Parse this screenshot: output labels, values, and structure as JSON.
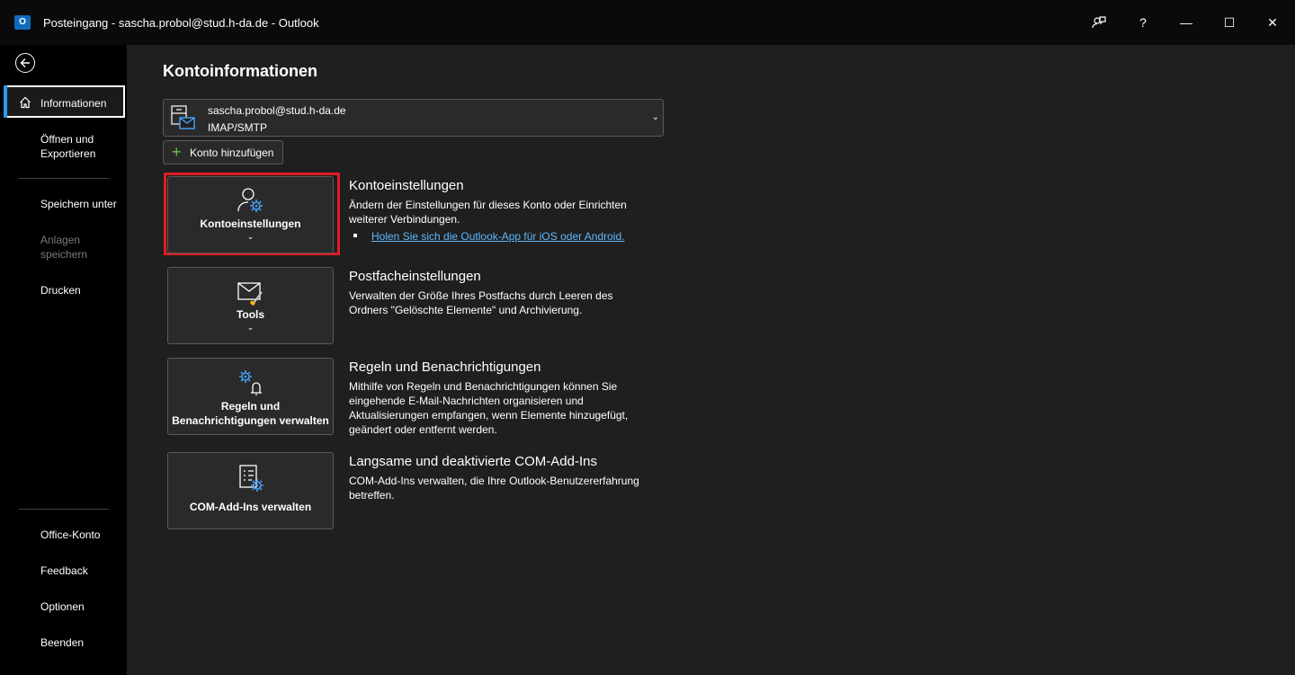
{
  "window": {
    "title": "Posteingang - sascha.probol@stud.h-da.de  -  Outlook",
    "app_icon": "outlook-logo",
    "app_icon_letter": "O",
    "controls": [
      "feedback-icon",
      "help-icon",
      "minimize-icon",
      "maximize-icon",
      "close-icon"
    ],
    "help_glyph": "?",
    "minimize_glyph": "—",
    "maximize_glyph": "☐",
    "close_glyph": "✕"
  },
  "sidebar": {
    "back_icon": "back-arrow-icon",
    "items": [
      {
        "label": "Informationen",
        "active": true,
        "icon": "home-icon"
      },
      {
        "label": "Öffnen und\nExportieren"
      },
      {
        "label": "Speichern unter"
      },
      {
        "label": "Anlagen\nspeichern",
        "disabled": true
      },
      {
        "label": "Drucken"
      },
      {
        "label": "Office-Konto"
      },
      {
        "label": "Feedback"
      },
      {
        "label": "Optionen"
      },
      {
        "label": "Beenden"
      }
    ]
  },
  "main": {
    "title": "Kontoinformationen",
    "account": {
      "email": "sascha.probol@stud.h-da.de",
      "type": "IMAP/SMTP",
      "chevron": "⌄"
    },
    "add_account_label": "Konto hinzufügen",
    "add_account_plus": "+",
    "sections": [
      {
        "tile_label": "Kontoeinstellungen",
        "has_chevron": true,
        "chevron": "⌄",
        "icon": "account-settings-icon",
        "heading": "Kontoeinstellungen",
        "text": "Ändern der Einstellungen für dieses Konto oder Einrichten weiterer Verbindungen.",
        "link": "Holen Sie sich die Outlook-App für iOS oder Android."
      },
      {
        "tile_label": "Tools",
        "has_chevron": true,
        "chevron": "⌄",
        "icon": "mailbox-tools-icon",
        "heading": "Postfacheinstellungen",
        "text": "Verwalten der Größe Ihres Postfachs durch Leeren des Ordners \"Gelöschte Elemente\" und Archivierung."
      },
      {
        "tile_label": "Regeln und\nBenachrichtigungen verwalten",
        "icon": "rules-alerts-icon",
        "heading": "Regeln und Benachrichtigungen",
        "text": "Mithilfe von Regeln und Benachrichtigungen können Sie eingehende E-Mail-Nachrichten organisieren und Aktualisierungen empfangen, wenn Elemente hinzugefügt, geändert oder entfernt werden."
      },
      {
        "tile_label": "COM-Add-Ins verwalten",
        "icon": "com-addins-icon",
        "heading": "Langsame und deaktivierte COM-Add-Ins",
        "text": "COM-Add-Ins verwalten, die Ihre Outlook-Benutzererfahrung betreffen."
      }
    ]
  },
  "colors": {
    "highlight": "#e01b24",
    "link": "#5db8ff",
    "accent": "#2899f5",
    "add_plus": "#6cc24a"
  }
}
